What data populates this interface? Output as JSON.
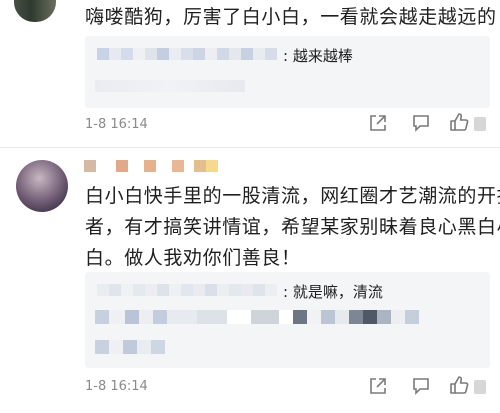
{
  "comment1": {
    "text": "嗨喽酷狗，厉害了白小白，一看就会越走越远的",
    "reply_text": ": 越来越棒",
    "timestamp": "1-8 16:14"
  },
  "comment2": {
    "lines": [
      "白小白快手里的一股清流，网红圈才艺潮流的开拓",
      "者，有才搞笑讲情谊，希望某家别昧着良心黑白小",
      "白。做人我劝你们善良！"
    ],
    "reply_text": ": 就是嘛，清流",
    "timestamp": "1-8 16:14"
  },
  "colors": {
    "reply_bg": "#f4f5f7",
    "meta_text": "#8a8a8a",
    "body_text": "#1f1f1f"
  },
  "icons": {
    "share": "share-icon",
    "comment": "comment-icon",
    "like": "thumbs-up-icon"
  }
}
